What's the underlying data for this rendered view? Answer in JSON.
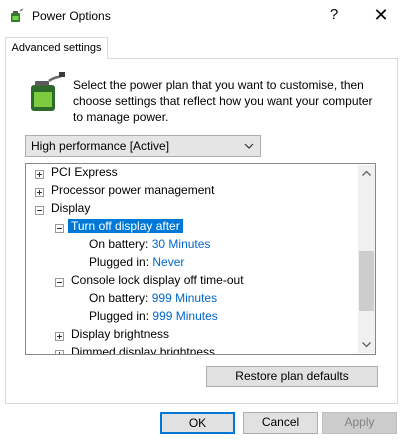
{
  "window": {
    "title": "Power Options",
    "help_glyph": "?",
    "close_glyph": "✕"
  },
  "tab": {
    "label": "Advanced settings"
  },
  "description": "Select the power plan that you want to customise, then choose settings that reflect how you want your computer to manage power.",
  "plan_select": {
    "value": "High performance [Active]"
  },
  "tree": {
    "items": [
      {
        "label": "PCI Express"
      },
      {
        "label": "Processor power management"
      },
      {
        "label": "Display"
      },
      {
        "label": "Turn off display after"
      },
      {
        "label": "On battery:",
        "value": "30 Minutes"
      },
      {
        "label": "Plugged in:",
        "value": "Never"
      },
      {
        "label": "Console lock display off time-out"
      },
      {
        "label": "On battery:",
        "value": "999 Minutes"
      },
      {
        "label": "Plugged in:",
        "value": "999 Minutes"
      },
      {
        "label": "Display brightness"
      },
      {
        "label": "Dimmed display brightness"
      }
    ]
  },
  "buttons": {
    "restore": "Restore plan defaults",
    "ok": "OK",
    "cancel": "Cancel",
    "apply": "Apply"
  },
  "colors": {
    "selection": "#0078d7",
    "value_link": "#0066cc",
    "accent_border": "#0078d7"
  }
}
